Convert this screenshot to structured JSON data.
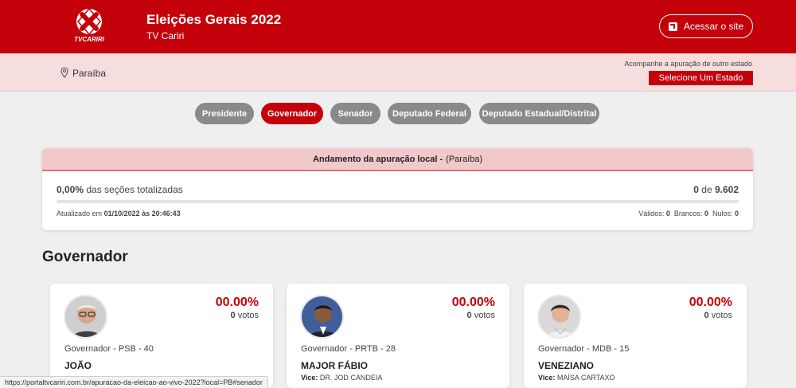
{
  "header": {
    "logo_text": "TVCARIRI",
    "title": "Eleições Gerais 2022",
    "subtitle": "TV Cariri",
    "access_button": "Acessar o site"
  },
  "state_bar": {
    "state_name": "Paraíba",
    "other_state_label": "Acompanhe a apuração de outro estado",
    "select_label": "Selecione Um Estado"
  },
  "tabs": [
    {
      "label": "Presidente",
      "active": false
    },
    {
      "label": "Governador",
      "active": true
    },
    {
      "label": "Senador",
      "active": false
    },
    {
      "label": "Deputado Federal",
      "active": false
    },
    {
      "label": "Deputado Estadual/Distrital",
      "active": false
    }
  ],
  "progress": {
    "title_bold": "Andamento da apuração local -",
    "title_region": "(Paraíba)",
    "sections_percent": "0,00%",
    "sections_label": "das seções totalizadas",
    "count_done": "0",
    "count_of": "de",
    "count_total": "9.602",
    "bar_fraction": 0,
    "updated_label": "Atualizado em",
    "updated_value": "01/10/2022 às 20:46:43",
    "valid_label": "Válidos:",
    "valid_value": "0",
    "blank_label": "Brancos:",
    "blank_value": "0",
    "null_label": "Nulos:",
    "null_value": "0"
  },
  "section_title": "Governador",
  "candidates": [
    {
      "percent": "00.00%",
      "votes": "0",
      "votes_label": "votos",
      "party": "Governador - PSB - 40",
      "name": "JOÃO",
      "vice_label": "",
      "vice_name": ""
    },
    {
      "percent": "00.00%",
      "votes": "0",
      "votes_label": "votos",
      "party": "Governador - PRTB - 28",
      "name": "MAJOR FÁBIO",
      "vice_label": "Vice:",
      "vice_name": "DR. JOD CANDEIA"
    },
    {
      "percent": "00.00%",
      "votes": "0",
      "votes_label": "votos",
      "party": "Governador - MDB - 15",
      "name": "VENEZIANO",
      "vice_label": "Vice:",
      "vice_name": "MAÍSA CARTAXO"
    }
  ],
  "status_url": "https://portaltvcariri.com.br/apuracao-da-eleicao-ao-vivo-2022?local=PB#senador",
  "colors": {
    "brand_red": "#c4000b",
    "tab_gray": "#8a8a8a",
    "highlight_pink": "#f2c9cb"
  }
}
